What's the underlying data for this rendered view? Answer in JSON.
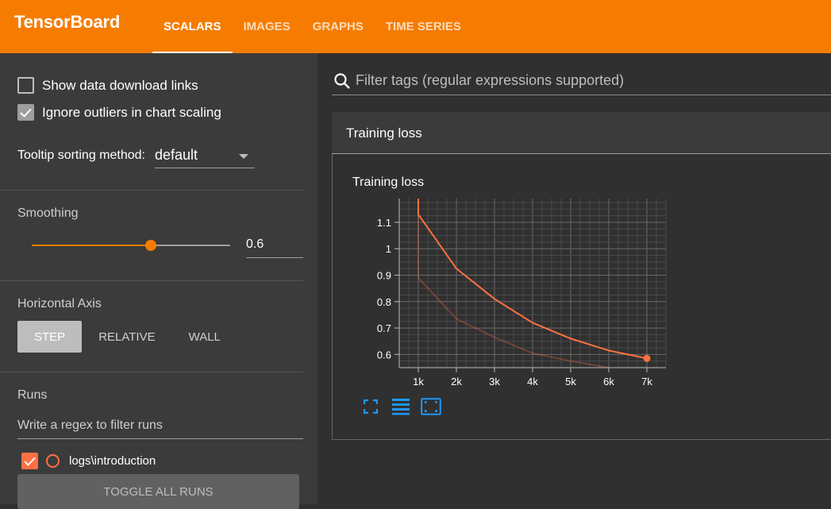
{
  "header": {
    "brand": "TensorBoard",
    "tabs": [
      "SCALARS",
      "IMAGES",
      "GRAPHS",
      "TIME SERIES"
    ]
  },
  "sidebar": {
    "show_download_links": {
      "label": "Show data download links",
      "checked": false
    },
    "ignore_outliers": {
      "label": "Ignore outliers in chart scaling",
      "checked": true
    },
    "tooltip_sorting_label": "Tooltip sorting method:",
    "tooltip_sorting_value": "default",
    "smoothing_title": "Smoothing",
    "smoothing_value": "0.6",
    "smoothing_fraction": 0.6,
    "horizontal_axis_title": "Horizontal Axis",
    "axis_options": [
      "STEP",
      "RELATIVE",
      "WALL"
    ],
    "runs_title": "Runs",
    "runs_filter_placeholder": "Write a regex to filter runs",
    "run_label": "logs\\introduction",
    "toggle_all": "TOGGLE ALL RUNS"
  },
  "main": {
    "filter_placeholder": "Filter tags (regular expressions supported)",
    "card_header": "Training loss",
    "card_title": "Training loss"
  },
  "colors": {
    "accent": "#f57c00",
    "run": "#ff7043",
    "tool_icon": "#2196f3"
  },
  "icons": [
    "search-icon",
    "check-icon",
    "expand-icon",
    "lines-icon",
    "fit-domain-icon"
  ],
  "chart_data": {
    "type": "line",
    "title": "Training loss",
    "xlabel": "",
    "ylabel": "",
    "xlim": [
      500,
      7500
    ],
    "ylim": [
      0.55,
      1.19
    ],
    "x_ticks": [
      "1k",
      "2k",
      "3k",
      "4k",
      "5k",
      "6k",
      "7k"
    ],
    "y_ticks": [
      "0.6",
      "0.7",
      "0.8",
      "0.9",
      "1",
      "1.1"
    ],
    "grid": true,
    "series": [
      {
        "smoothed": true,
        "x": [
          1000,
          1000,
          2000,
          3000,
          4000,
          5000,
          6000,
          7000
        ],
        "y": [
          1.19,
          1.13,
          0.925,
          0.81,
          0.72,
          0.66,
          0.615,
          0.585
        ]
      },
      {
        "smoothed": false,
        "x": [
          1000,
          1000,
          2000,
          3000,
          4000,
          5000,
          6000,
          7000
        ],
        "y": [
          1.19,
          0.89,
          0.735,
          0.665,
          0.605,
          0.575,
          0.55,
          0.525
        ]
      }
    ]
  }
}
